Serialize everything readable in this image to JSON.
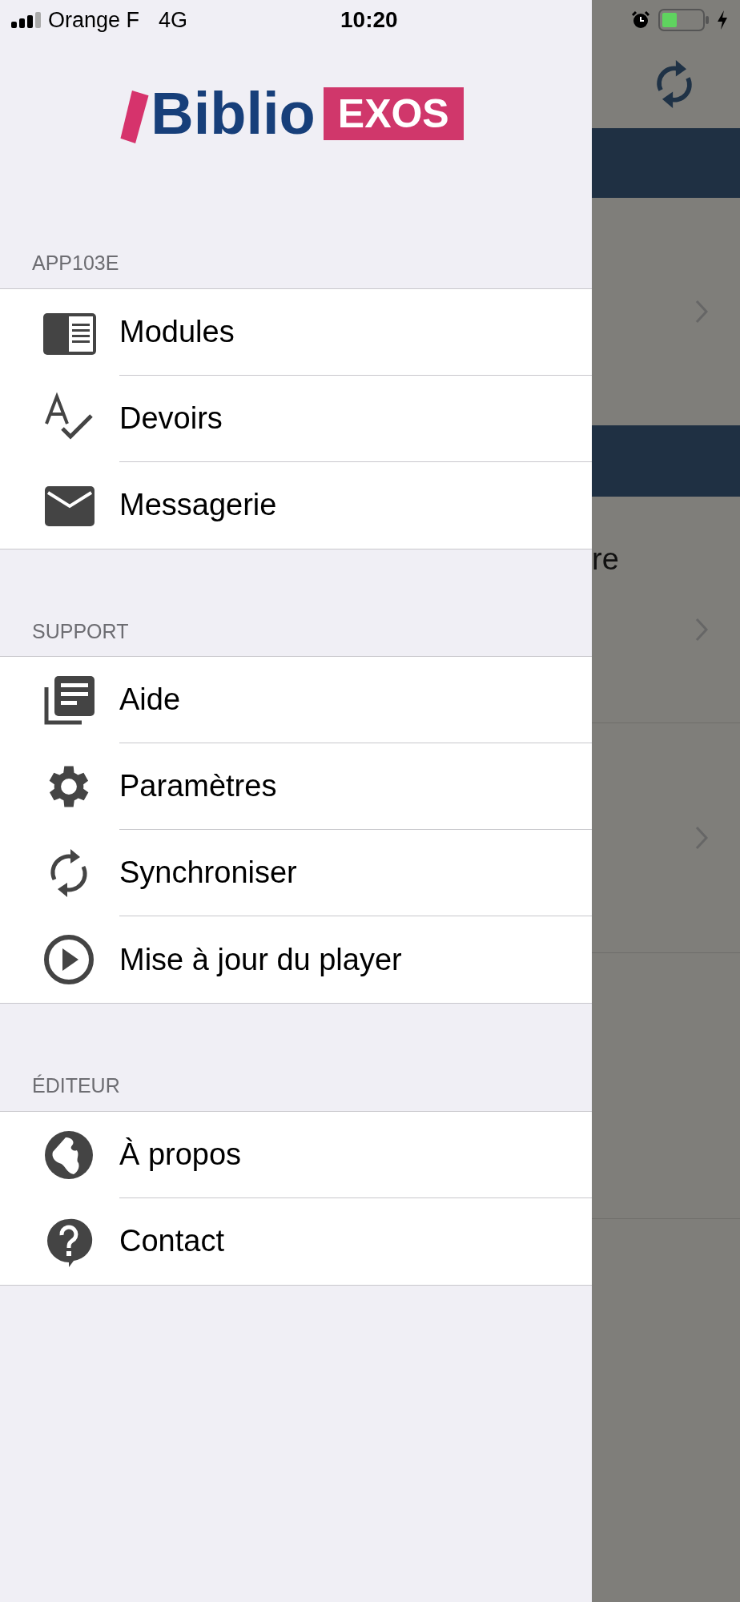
{
  "status_bar": {
    "carrier": "Orange F",
    "network": "4G",
    "time": "10:20"
  },
  "logo": {
    "main": "Biblio",
    "badge": "EXOS"
  },
  "sections": [
    {
      "title": "APP103E",
      "items": [
        {
          "label": "Modules",
          "kind": "modules"
        },
        {
          "label": "Devoirs",
          "kind": "spellcheck"
        },
        {
          "label": "Messagerie",
          "kind": "mail"
        }
      ]
    },
    {
      "title": "SUPPORT",
      "items": [
        {
          "label": "Aide",
          "kind": "library"
        },
        {
          "label": "Paramètres",
          "kind": "gear"
        },
        {
          "label": "Synchroniser",
          "kind": "sync"
        },
        {
          "label": "Mise à jour du player",
          "kind": "play"
        }
      ]
    },
    {
      "title": "ÉDITEUR",
      "items": [
        {
          "label": "À propos",
          "kind": "globe"
        },
        {
          "label": "Contact",
          "kind": "help"
        }
      ]
    }
  ],
  "background_page": {
    "partial_text": "re"
  }
}
